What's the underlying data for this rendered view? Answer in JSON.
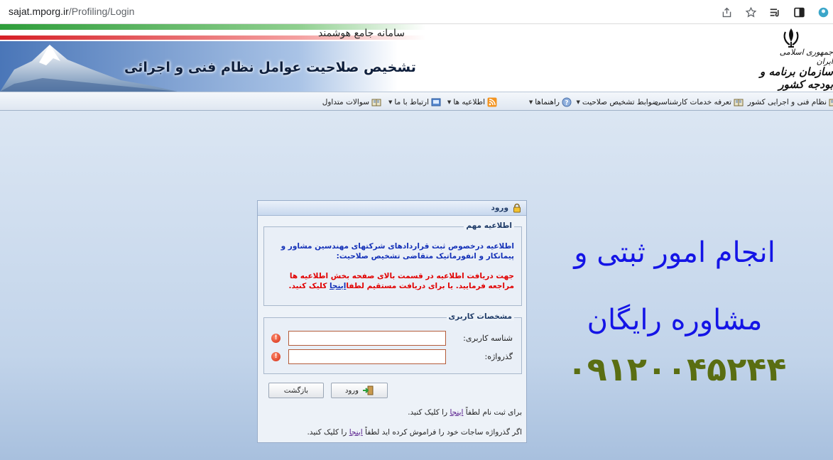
{
  "browser": {
    "url_host": "sajat.mporg.ir",
    "url_path": "/Profiling/Login"
  },
  "banner": {
    "tagline": "سامانه جامع هوشمند",
    "headline": "تشخیص صلاحیت عوامل نظام فنی و اجرائی",
    "org_line1": "جمهوری اسلامی ایران",
    "org_line2": "سازمان برنامه و بودجه کشور"
  },
  "menu": {
    "items": [
      {
        "label": "نظام فنی و اجرایی کشور",
        "icon": "book-icon"
      },
      {
        "label": "تعرفه خدمات کارشناسی",
        "icon": "book-icon"
      },
      {
        "label": "ضوابط تشخیص صلاحیت",
        "icon": "none"
      },
      {
        "label": "راهنماها",
        "icon": "help-icon"
      },
      {
        "label": "اطلاعیه ها",
        "icon": "rss-icon"
      },
      {
        "label": "ارتباط با ما",
        "icon": "contact-icon"
      },
      {
        "label": "سوالات متداول",
        "icon": "book-icon"
      }
    ]
  },
  "login": {
    "title": "ورود",
    "notice_legend": "اطلاعیه مهم",
    "notice_blue": "اطلاعیه درخصوص ثبت قراردادهای شرکتهای مهندسین مشاور و پیمانکار و انفورماتیک متقاضی تشخیص صلاحیت:",
    "notice_red_1": "جهت دریافت اطلاعیه در قسمت بالای صفحه بخش اطلاعیه ها مراجعه فرمایید. یا برای دریافت مستقیم لطفا",
    "notice_red_link": "اینجا",
    "notice_red_2": "کلیک کنید.",
    "userinfo_legend": "مشخصات کاربری",
    "username_label": "شناسه کاربری:",
    "password_label": "گذرواژه:",
    "username_value": "",
    "password_value": "",
    "login_button": "ورود",
    "back_button": "بازگشت",
    "register_pre": "برای ثبت نام لطفاً",
    "register_link": "اینجا",
    "register_post": "را کلیک کنید.",
    "forgot_pre": "اگر گذرواژه ساجات خود را فراموش کرده اید لطفاً",
    "forgot_link": "اینجا",
    "forgot_post": "را کلیک کنید."
  },
  "ad": {
    "line1": "انجام امور ثبتی و",
    "line2": "مشاوره رایگان",
    "phone": "۰۹۱۲۰۰۴۵۲۴۴"
  },
  "colors": {
    "ad_blue": "#1414e6",
    "ad_green": "#5a6e12",
    "notice_red": "#e10000",
    "notice_blue": "#1532b8"
  }
}
